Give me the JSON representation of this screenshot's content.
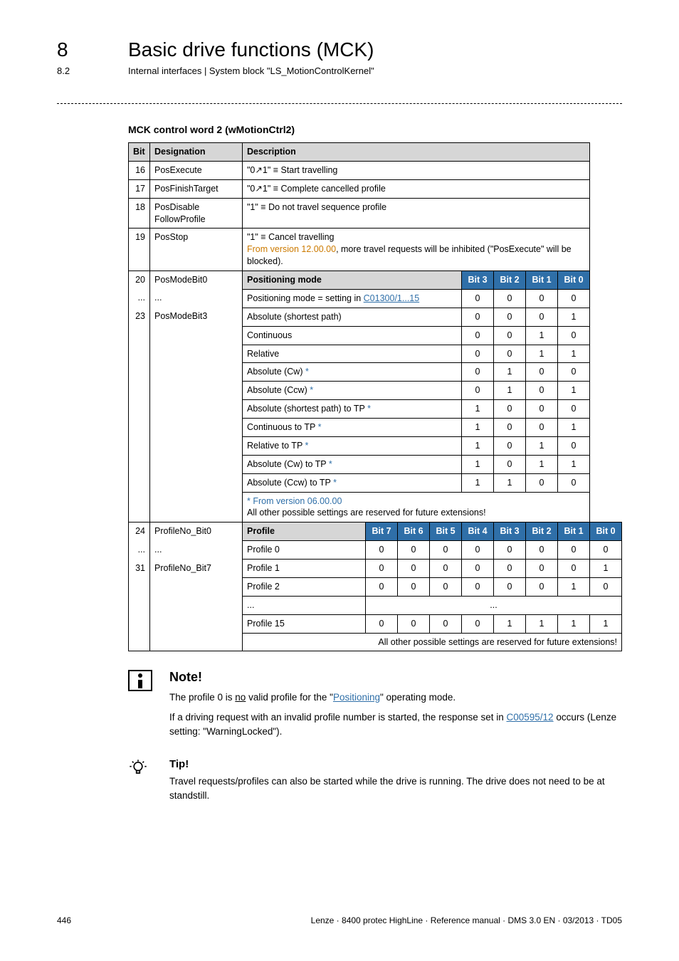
{
  "header": {
    "chapter_num": "8",
    "chapter_title": "Basic drive functions (MCK)",
    "sub_num": "8.2",
    "sub_title": "Internal interfaces | System block \"LS_MotionControlKernel\""
  },
  "section_title": "MCK control word 2 (wMotionCtrl2)",
  "table": {
    "head": {
      "bit": "Bit",
      "desig": "Designation",
      "desc": "Description"
    },
    "r16": {
      "bit": "16",
      "desig": "PosExecute",
      "desc": "\"0↗1\" ≡ Start travelling"
    },
    "r17": {
      "bit": "17",
      "desig": "PosFinishTarget",
      "desc": "\"0↗1\" ≡ Complete cancelled profile"
    },
    "r18": {
      "bit": "18",
      "desig": "PosDisable FollowProfile",
      "desc": "\"1\" ≡ Do not travel sequence profile"
    },
    "r19": {
      "bit": "19",
      "desig": "PosStop",
      "desc_a": "\"1\" ≡ Cancel travelling",
      "desc_b": "From version 12.00.00",
      "desc_c": ", more travel requests will be inhibited (\"PosExecute\" will be blocked)."
    },
    "pos": {
      "bit_a": "20",
      "desig_a": "PosModeBit0",
      "dots": "...",
      "bit_b": "23",
      "desig_b": "PosModeBit3",
      "hdr_label": "Positioning mode",
      "b3": "Bit 3",
      "b2": "Bit 2",
      "b1": "Bit 1",
      "b0": "Bit 0",
      "rows": [
        {
          "label_a": "Positioning mode = setting in ",
          "label_link": "C01300/1...15",
          "v": [
            "0",
            "0",
            "0",
            "0"
          ]
        },
        {
          "label": "Absolute (shortest path)",
          "v": [
            "0",
            "0",
            "0",
            "1"
          ]
        },
        {
          "label": "Continuous",
          "v": [
            "0",
            "0",
            "1",
            "0"
          ]
        },
        {
          "label": "Relative",
          "v": [
            "0",
            "0",
            "1",
            "1"
          ]
        },
        {
          "label_a": "Absolute (Cw)",
          "star": " *",
          "v": [
            "0",
            "1",
            "0",
            "0"
          ]
        },
        {
          "label_a": "Absolute (Ccw)",
          "star": " *",
          "v": [
            "0",
            "1",
            "0",
            "1"
          ]
        },
        {
          "label_a": "Absolute (shortest path) to TP",
          "star": " *",
          "v": [
            "1",
            "0",
            "0",
            "0"
          ]
        },
        {
          "label_a": "Continuous to TP",
          "star": " *",
          "v": [
            "1",
            "0",
            "0",
            "1"
          ]
        },
        {
          "label_a": "Relative to TP",
          "star": " *",
          "v": [
            "1",
            "0",
            "1",
            "0"
          ]
        },
        {
          "label_a": "Absolute (Cw) to TP",
          "star": " *",
          "v": [
            "1",
            "0",
            "1",
            "1"
          ]
        },
        {
          "label_a": "Absolute (Ccw) to TP",
          "star": " *",
          "v": [
            "1",
            "1",
            "0",
            "0"
          ]
        }
      ],
      "footnote_a": "* From version 06.00.00",
      "footnote_b": "All other possible settings are reserved for future extensions!"
    },
    "prof": {
      "bit_a": "24",
      "desig_a": "ProfileNo_Bit0",
      "dots": "...",
      "bit_b": "31",
      "desig_b": "ProfileNo_Bit7",
      "hdr_label": "Profile",
      "b7": "Bit 7",
      "b6": "Bit 6",
      "b5": "Bit 5",
      "b4": "Bit 4",
      "b3": "Bit 3",
      "b2": "Bit 2",
      "b1": "Bit 1",
      "b0": "Bit 0",
      "rows": [
        {
          "label": "Profile 0",
          "v": [
            "0",
            "0",
            "0",
            "0",
            "0",
            "0",
            "0",
            "0"
          ]
        },
        {
          "label": "Profile 1",
          "v": [
            "0",
            "0",
            "0",
            "0",
            "0",
            "0",
            "0",
            "1"
          ]
        },
        {
          "label": "Profile 2",
          "v": [
            "0",
            "0",
            "0",
            "0",
            "0",
            "0",
            "1",
            "0"
          ]
        },
        {
          "label": "...",
          "mid": "..."
        },
        {
          "label": "Profile 15",
          "v": [
            "0",
            "0",
            "0",
            "0",
            "1",
            "1",
            "1",
            "1"
          ]
        }
      ],
      "footnote": "All other possible settings are reserved for future extensions!"
    }
  },
  "note": {
    "title": "Note!",
    "p1_a": "The profile 0 is ",
    "p1_no": "no",
    "p1_b": " valid profile for the \"",
    "p1_link": "Positioning",
    "p1_c": "\" operating mode.",
    "p2_a": "If a driving request with an invalid profile number is started, the response set in ",
    "p2_link": "C00595/12",
    "p2_b": " occurs (Lenze setting: \"WarningLocked\")."
  },
  "tip": {
    "title": "Tip!",
    "text": "Travel requests/profiles can also be started while the drive is running. The drive does not need to be at standstill."
  },
  "footer": {
    "page": "446",
    "info": "Lenze · 8400 protec HighLine · Reference manual · DMS 3.0 EN · 03/2013 · TD05"
  }
}
